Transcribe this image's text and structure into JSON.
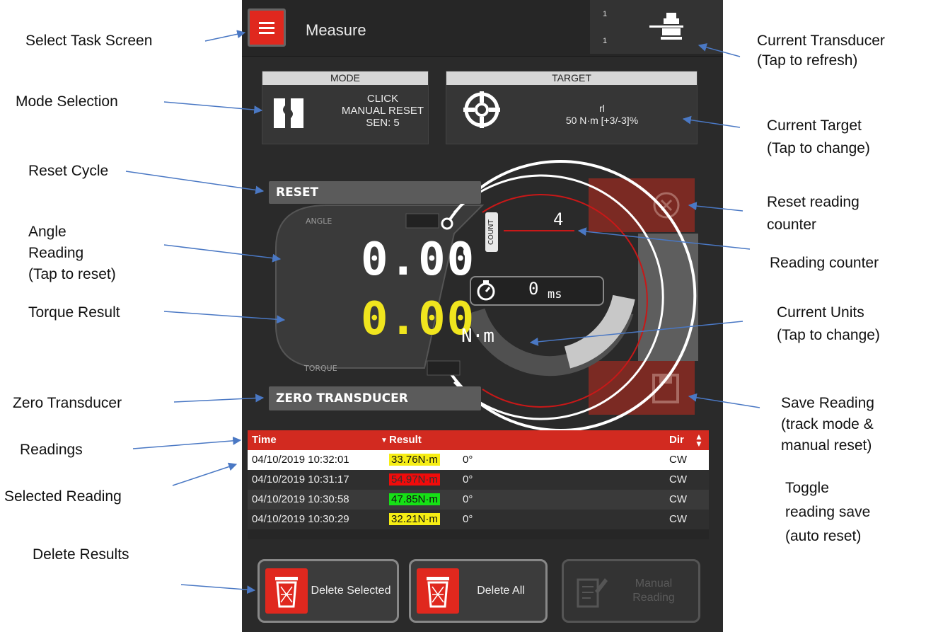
{
  "app": {
    "title": "Measure"
  },
  "transducer": {
    "line1": "1",
    "line2": "1"
  },
  "mode": {
    "header": "MODE",
    "line1": "CLICK",
    "line2": "MANUAL RESET",
    "line3": "SEN: 5"
  },
  "target": {
    "header": "TARGET",
    "line1": "rl",
    "line2": "50 N·m [+3/-3]%"
  },
  "display": {
    "reset_label": "RESET",
    "zero_label": "ZERO TRANSDUCER",
    "angle_label": "ANGLE",
    "torque_label": "TORQUE",
    "angle_value": "0.00",
    "degree_symbol": "o",
    "torque_value": "0.00",
    "units": "N·m",
    "count_label": "COUNT",
    "count_value": "4",
    "timer_value": "0",
    "timer_unit": "ms"
  },
  "table": {
    "headers": {
      "time": "Time",
      "result": "Result",
      "dir": "Dir"
    },
    "rows": [
      {
        "time": "04/10/2019 10:32:01",
        "result": "33.76N·m",
        "angle": "0°",
        "dir": "CW",
        "status": "yellow"
      },
      {
        "time": "04/10/2019 10:31:17",
        "result": "54.97N·m",
        "angle": "0°",
        "dir": "CW",
        "status": "red"
      },
      {
        "time": "04/10/2019 10:30:58",
        "result": "47.85N·m",
        "angle": "0°",
        "dir": "CW",
        "status": "green"
      },
      {
        "time": "04/10/2019 10:30:29",
        "result": "32.21N·m",
        "angle": "0°",
        "dir": "CW",
        "status": "yellow"
      }
    ]
  },
  "buttons": {
    "delete_selected": "Delete Selected",
    "delete_all": "Delete All",
    "manual": "Manual Reading"
  },
  "annotations": {
    "select_task": "Select Task Screen",
    "mode_selection": "Mode Selection",
    "reset_cycle": "Reset Cycle",
    "angle_1": "Angle",
    "angle_2": "Reading",
    "angle_3": "(Tap to reset)",
    "torque_result": "Torque Result",
    "zero_transducer": "Zero Transducer",
    "readings": "Readings",
    "selected_reading": "Selected Reading",
    "delete_results": "Delete Results",
    "cur_xd_1": "Current Transducer",
    "cur_xd_2": "(Tap to refresh)",
    "cur_target_1": "Current Target",
    "cur_target_2": "(Tap to change)",
    "reset_counter_1": "Reset reading",
    "reset_counter_2": "counter",
    "reading_counter": "Reading counter",
    "cur_units_1": "Current Units",
    "cur_units_2": "(Tap to change)",
    "save_1": "Save Reading",
    "save_2": "(track mode &",
    "save_3": "manual reset)",
    "toggle_1": "Toggle",
    "toggle_2": "reading save",
    "toggle_3": "(auto reset)"
  },
  "colors": {
    "accent": "#e0281e",
    "torque": "#f0e51e",
    "arrow": "#4a78c4"
  }
}
